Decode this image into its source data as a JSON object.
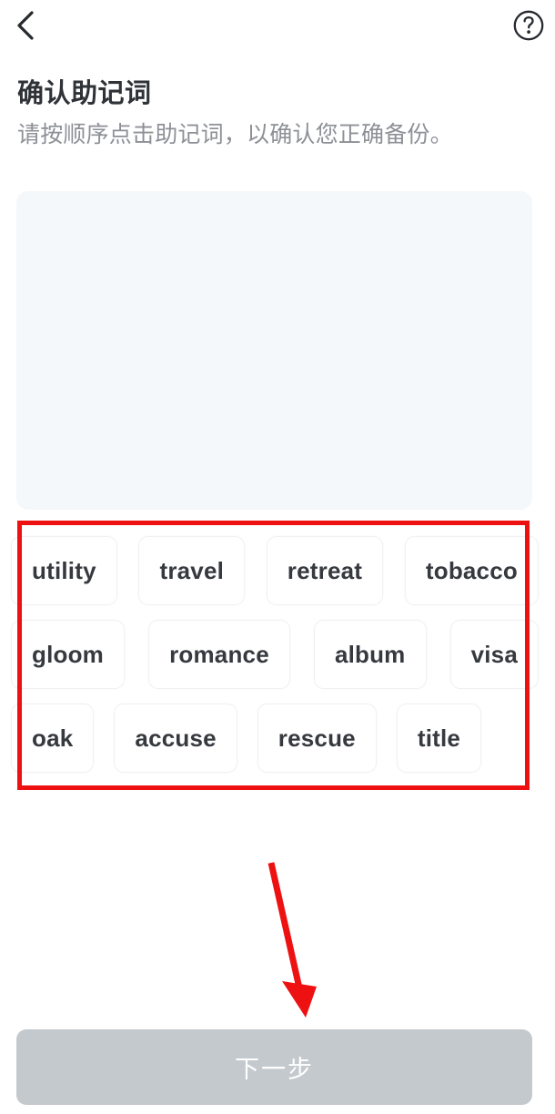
{
  "topbar": {
    "back_icon": "chevron-left-icon",
    "help_icon": "question-mark-circle-icon",
    "help_glyph": "?"
  },
  "header": {
    "title": "确认助记词",
    "subtitle": "请按顺序点击助记词，以确认您正确备份。"
  },
  "selected_panel": {
    "words": [],
    "background_color": "#f4f8fb"
  },
  "word_bank": {
    "rows": [
      [
        "utility",
        "travel",
        "retreat",
        "tobacco"
      ],
      [
        "gloom",
        "romance",
        "album",
        "visa"
      ],
      [
        "oak",
        "accuse",
        "rescue",
        "title"
      ]
    ],
    "words": [
      "utility",
      "travel",
      "retreat",
      "tobacco",
      "gloom",
      "romance",
      "album",
      "visa",
      "oak",
      "accuse",
      "rescue",
      "title"
    ]
  },
  "footer": {
    "next_label": "下一步",
    "next_disabled": true,
    "next_color": "#c4c9ce"
  },
  "annotations": {
    "highlight_color": "#ee1111",
    "box_target": "word-bank",
    "arrow_target": "next-button"
  }
}
